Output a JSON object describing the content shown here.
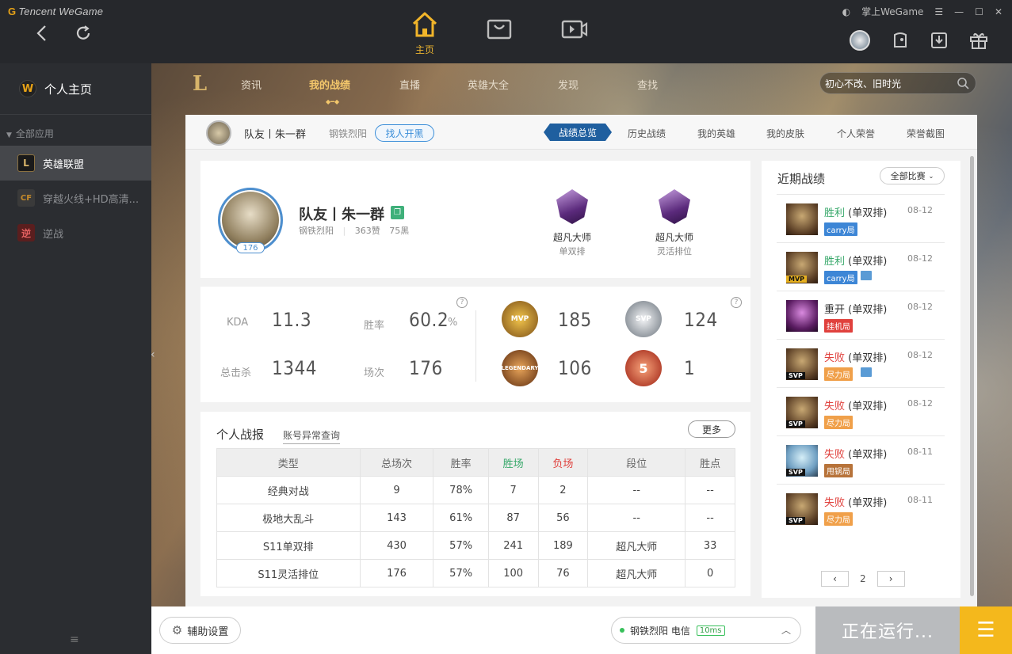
{
  "app": {
    "brand": "Tencent WeGame",
    "top_center_tabs": [
      {
        "label": "主页",
        "icon": "home-icon",
        "active": true
      },
      {
        "label": "",
        "icon": "store-icon"
      },
      {
        "label": "",
        "icon": "video-icon"
      }
    ],
    "account_label": "掌上WeGame"
  },
  "sidebar": {
    "home_label": "个人主页",
    "all_apps_label": "全部应用",
    "items": [
      {
        "label": "英雄联盟",
        "active": true
      },
      {
        "label": "穿越火线+HD高清..."
      },
      {
        "label": "逆战"
      }
    ]
  },
  "game_nav": {
    "items": [
      "资讯",
      "我的战绩",
      "直播",
      "英雄大全",
      "发现",
      "查找"
    ],
    "active": "我的战绩",
    "search_value": "初心不改、旧时光"
  },
  "profile_bar": {
    "name": "队友丨朱一群",
    "server": "钢铁烈阳",
    "find_button": "找人开黑",
    "tabs": [
      "战绩总览",
      "历史战绩",
      "我的英雄",
      "我的皮肤",
      "个人荣誉",
      "荣誉截图"
    ],
    "active_tab": "战绩总览"
  },
  "profile": {
    "level": "176",
    "name": "队友丨朱一群",
    "server": "钢铁烈阳",
    "likes": "363赞",
    "blacks": "75黑",
    "ranks": [
      {
        "tier": "超凡大师",
        "queue": "单双排"
      },
      {
        "tier": "超凡大师",
        "queue": "灵活排位"
      }
    ]
  },
  "stats": {
    "kda_label": "KDA",
    "kda": "11.3",
    "winrate_label": "胜率",
    "winrate": "60.2",
    "winrate_unit": "%",
    "kills_label": "总击杀",
    "kills": "1344",
    "games_label": "场次",
    "games": "176",
    "q": "?",
    "medals": [
      {
        "name": "MVP",
        "count": "185",
        "color": "#c8891c"
      },
      {
        "name": "SVP",
        "count": "124",
        "color": "#9aa3ad"
      },
      {
        "name": "LEGENDARY",
        "count": "106",
        "color": "#b86a25"
      },
      {
        "name": "5",
        "count": "1",
        "color": "#d4461f"
      }
    ]
  },
  "report": {
    "title": "个人战报",
    "query_link": "账号异常查询",
    "more": "更多",
    "headers": [
      "类型",
      "总场次",
      "胜率",
      "胜场",
      "负场",
      "段位",
      "胜点"
    ],
    "rows": [
      [
        "经典对战",
        "9",
        "78%",
        "7",
        "2",
        "--",
        "--"
      ],
      [
        "极地大乱斗",
        "143",
        "61%",
        "87",
        "56",
        "--",
        "--"
      ],
      [
        "S11单双排",
        "430",
        "57%",
        "241",
        "189",
        "超凡大师",
        "33"
      ],
      [
        "S11灵活排位",
        "176",
        "57%",
        "100",
        "76",
        "超凡大师",
        "0"
      ]
    ]
  },
  "recent": {
    "title": "近期战绩",
    "filter": "全部比赛",
    "items": [
      {
        "result": "胜利",
        "mode": "(单双排)",
        "date": "08-12",
        "pill": "carry局",
        "pill_color": "#3d86d6",
        "tag": "",
        "kind": "win",
        "avatar": "a",
        "pic": false
      },
      {
        "result": "胜利",
        "mode": "(单双排)",
        "date": "08-12",
        "pill": "carry局",
        "pill_color": "#3d86d6",
        "tag": "MVP",
        "kind": "win",
        "avatar": "a",
        "pic": true
      },
      {
        "result": "重开",
        "mode": "(单双排)",
        "date": "08-12",
        "pill": "挂机局",
        "pill_color": "#e0413d",
        "tag": "",
        "kind": "neu",
        "avatar": "b",
        "pic": false
      },
      {
        "result": "失败",
        "mode": "(单双排)",
        "date": "08-12",
        "pill": "尽力局",
        "pill_color": "#f0a04a",
        "tag": "SVP",
        "kind": "lose",
        "avatar": "a",
        "pic": true
      },
      {
        "result": "失败",
        "mode": "(单双排)",
        "date": "08-12",
        "pill": "尽力局",
        "pill_color": "#f0a04a",
        "tag": "SVP",
        "kind": "lose",
        "avatar": "a",
        "pic": false
      },
      {
        "result": "失败",
        "mode": "(单双排)",
        "date": "08-11",
        "pill": "甩锅局",
        "pill_color": "#b7733a",
        "tag": "SVP",
        "kind": "lose",
        "avatar": "c",
        "pic": false
      },
      {
        "result": "失败",
        "mode": "(单双排)",
        "date": "08-11",
        "pill": "尽力局",
        "pill_color": "#f0a04a",
        "tag": "SVP",
        "kind": "lose",
        "avatar": "a",
        "pic": false
      }
    ],
    "page": "2"
  },
  "bottom": {
    "assist": "辅助设置",
    "server": "钢铁烈阳 电信",
    "ping": "10ms",
    "running": "正在运行..."
  }
}
